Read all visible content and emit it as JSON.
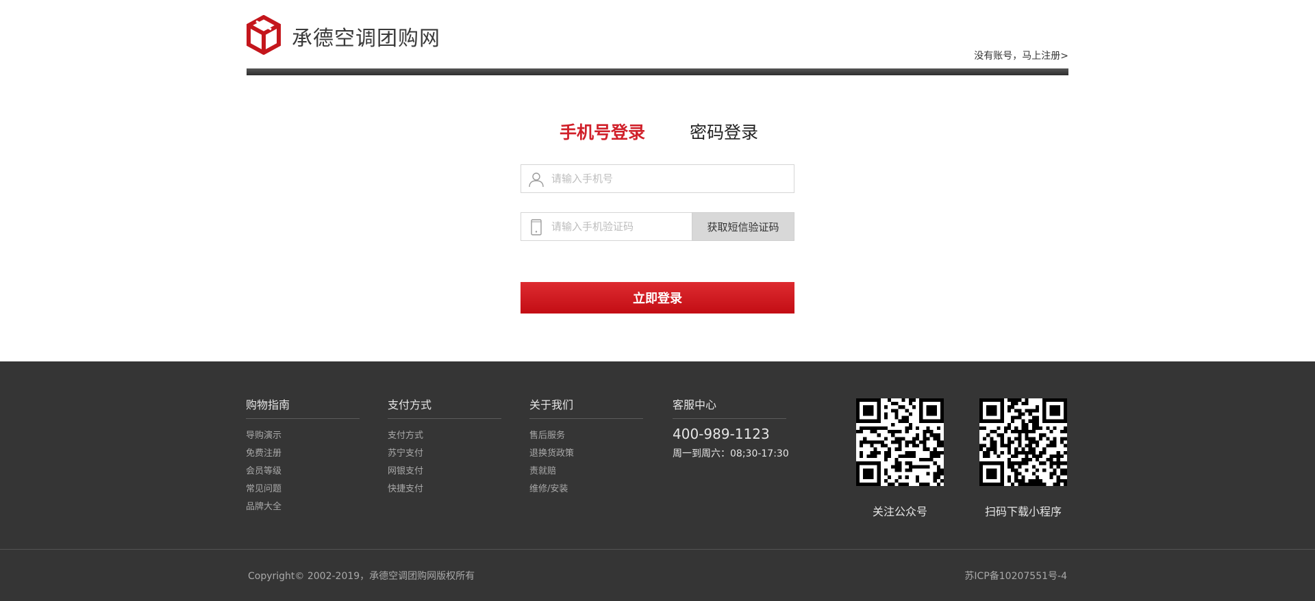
{
  "header": {
    "site_name": "承德空调团购网",
    "register_link": "没有账号，马上注册>"
  },
  "login": {
    "tabs": [
      {
        "label": "手机号登录",
        "active": true
      },
      {
        "label": "密码登录",
        "active": false
      }
    ],
    "phone_placeholder": "请输入手机号",
    "code_placeholder": "请输入手机验证码",
    "sms_button": "获取短信验证码",
    "submit_button": "立即登录"
  },
  "footer": {
    "columns": [
      {
        "title": "购物指南",
        "items": [
          "导购演示",
          "免费注册",
          "会员等级",
          "常见问题",
          "品牌大全"
        ]
      },
      {
        "title": "支付方式",
        "items": [
          "支付方式",
          "苏宁支付",
          "网银支付",
          "快捷支付"
        ]
      },
      {
        "title": "关于我们",
        "items": [
          "售后服务",
          "退换货政策",
          "责就赔",
          "维修/安装"
        ]
      }
    ],
    "service": {
      "title": "客服中心",
      "phone": "400-989-1123",
      "hours": "周一到周六：08;30-17:30"
    },
    "qr_codes": [
      {
        "caption": "关注公众号"
      },
      {
        "caption": "扫码下载小程序"
      }
    ],
    "copyright": "Copyright© 2002-2019，承德空调团购网版权所有",
    "icp": "苏ICP备10207551号-4"
  },
  "colors": {
    "brand_red": "#d0202a",
    "footer_bg": "#353535"
  },
  "icons": {
    "logo": "cube-logo-icon",
    "phone_field": "user-icon",
    "code_field": "mobile-phone-icon"
  }
}
